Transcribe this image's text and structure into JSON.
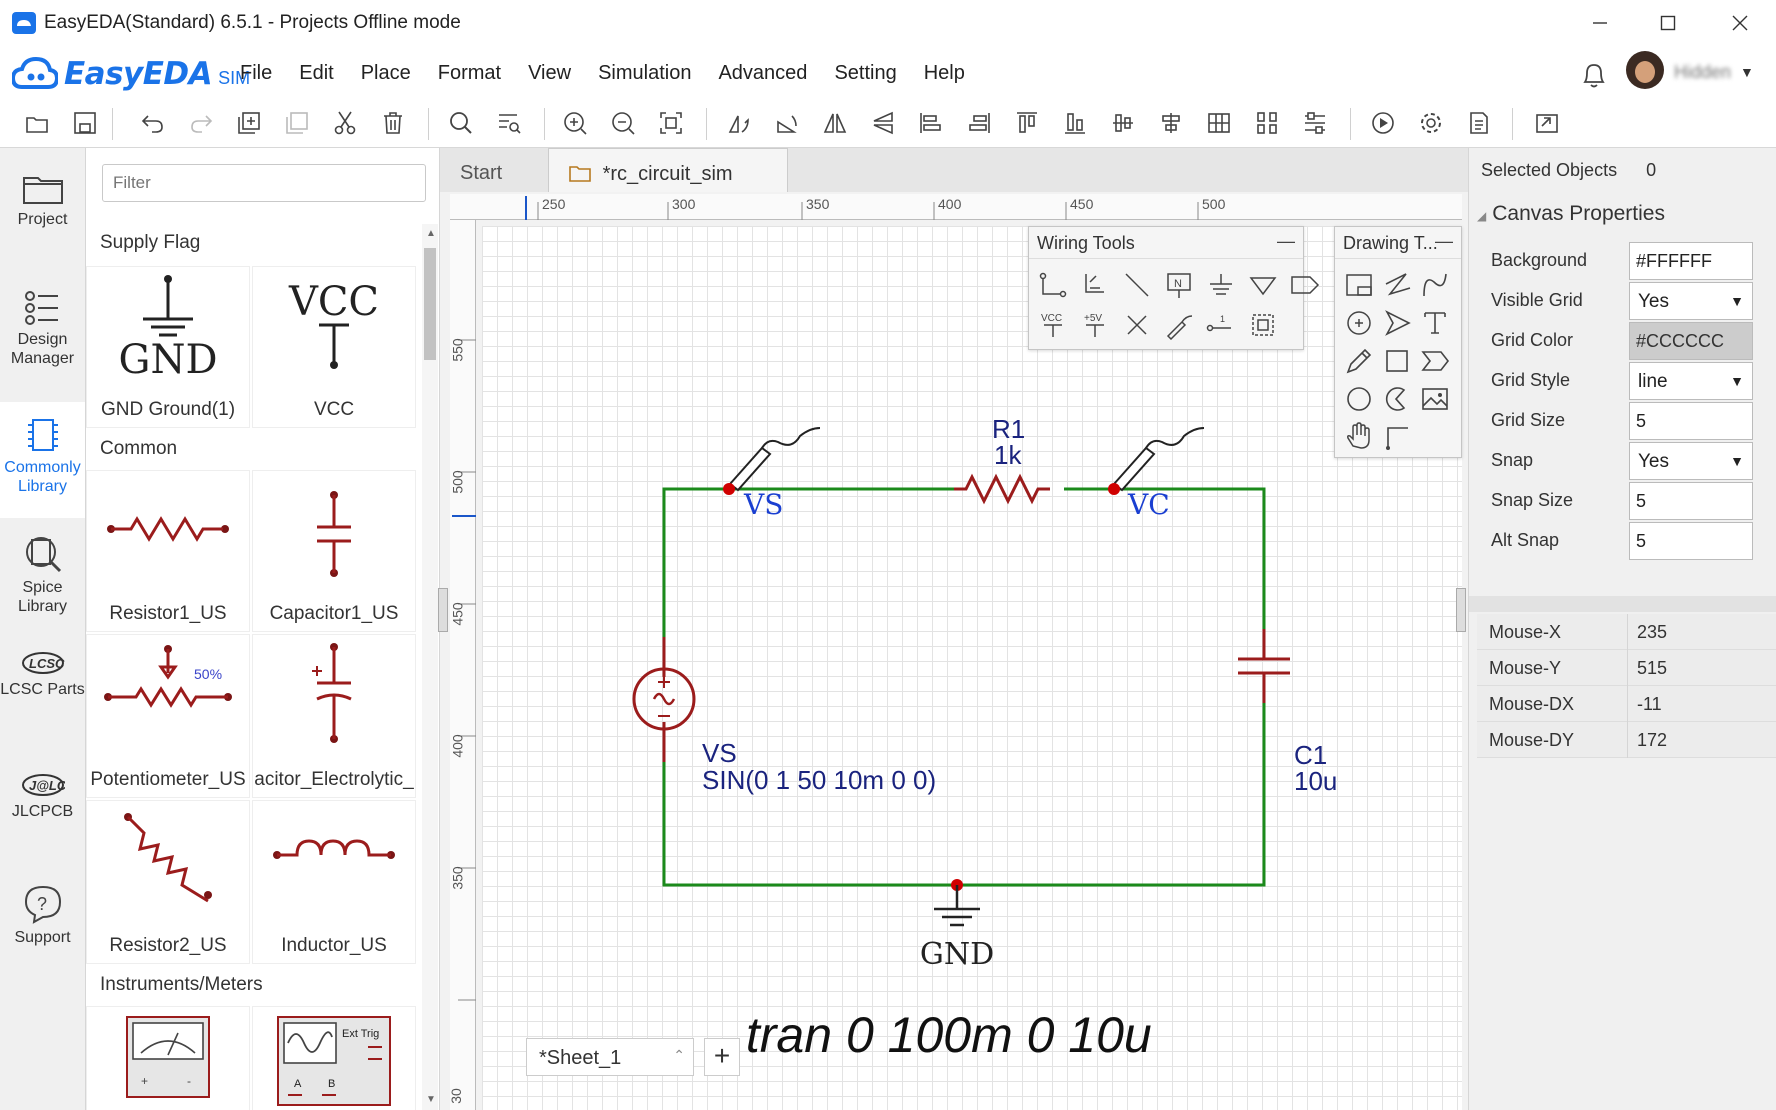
{
  "window": {
    "title": "EasyEDA(Standard) 6.5.1 - Projects Offline mode"
  },
  "brand": {
    "logo_text": "EasyEDA",
    "logo_suffix": "SIM",
    "color": "#1a73e8"
  },
  "menu": [
    "File",
    "Edit",
    "Place",
    "Format",
    "View",
    "Simulation",
    "Advanced",
    "Setting",
    "Help"
  ],
  "user": {
    "name": "Hidden"
  },
  "toolbar": {
    "icons": [
      "open-folder-icon",
      "save-icon",
      "undo-icon",
      "redo-icon",
      "copy-icon",
      "paste-icon",
      "cut-icon",
      "delete-icon",
      "search-icon",
      "find-list-icon",
      "zoom-in-icon",
      "zoom-out-icon",
      "fit-icon",
      "rotate-left-icon",
      "rotate-right-icon",
      "flip-horizontal-icon",
      "flip-vertical-icon",
      "align-left-icon",
      "align-right-icon",
      "align-top-icon",
      "align-bottom-icon",
      "align-center-v-icon",
      "align-center-h-icon",
      "distribute-h-icon",
      "distribute-v-icon",
      "align-grid-icon",
      "run-simulation-icon",
      "settings-icon",
      "document-icon",
      "export-icon"
    ]
  },
  "left_nav": [
    {
      "id": "project",
      "label": "Project"
    },
    {
      "id": "design-manager",
      "label": "Design Manager"
    },
    {
      "id": "commonly-library",
      "label": "Commonly Library",
      "active": true
    },
    {
      "id": "spice-library",
      "label": "Spice Library"
    },
    {
      "id": "lcsc-parts",
      "label": "LCSC Parts"
    },
    {
      "id": "jlcpcb",
      "label": "JLCPCB"
    },
    {
      "id": "support",
      "label": "Support"
    }
  ],
  "library": {
    "filter_placeholder": "Filter",
    "sections": [
      {
        "title": "Supply Flag",
        "items": [
          "GND Ground(1)",
          "VCC"
        ]
      },
      {
        "title": "Common",
        "items": [
          "Resistor1_US",
          "Capacitor1_US",
          "Potentiometer_US",
          "acitor_Electrolytic_",
          "Resistor2_US",
          "Inductor_US"
        ]
      },
      {
        "title": "Instruments/Meters",
        "items": []
      }
    ],
    "symbol_text": {
      "gnd": "GND",
      "vcc": "VCC",
      "pot_pct": "50%",
      "ext_trig": "Ext Trig",
      "a": "A",
      "b": "B"
    }
  },
  "tabs": [
    {
      "label": "Start"
    },
    {
      "label": "*rc_circuit_sim",
      "active": true
    }
  ],
  "ruler": {
    "top": [
      "250",
      "300",
      "350",
      "400",
      "450",
      "500"
    ],
    "left": [
      "550",
      "500",
      "450",
      "400",
      "350",
      "30"
    ]
  },
  "wiring_tools": {
    "title": "Wiring Tools",
    "labels": {
      "vcc": "VCC",
      "p5v": "+5V",
      "net": "N",
      "pin": "1"
    }
  },
  "drawing_tools": {
    "title": "Drawing T..."
  },
  "schematic": {
    "probe1": "VS",
    "probe2": "VC",
    "r1_name": "R1",
    "r1_value": "1k",
    "source_name": "VS",
    "source_value": "SIN(0 1 50 10m 0 0)",
    "c1_name": "C1",
    "c1_value": "10u",
    "ground": "GND",
    "directive": ".tran 0 100m 0 10u",
    "wire_color": "#1b8a1b",
    "component_color": "#9b1c1c",
    "label_color": "#1a237e"
  },
  "sheet": {
    "label": "*Sheet_1",
    "add": "+"
  },
  "properties": {
    "selected_label": "Selected Objects",
    "selected_count": "0",
    "section_title": "Canvas Properties",
    "rows": [
      {
        "label": "Background",
        "value": "#FFFFFF",
        "kind": "input"
      },
      {
        "label": "Visible Grid",
        "value": "Yes",
        "kind": "select"
      },
      {
        "label": "Grid Color",
        "value": "#CCCCCC",
        "kind": "color"
      },
      {
        "label": "Grid Style",
        "value": "line",
        "kind": "select"
      },
      {
        "label": "Grid Size",
        "value": "5",
        "kind": "input"
      },
      {
        "label": "Snap",
        "value": "Yes",
        "kind": "select"
      },
      {
        "label": "Snap Size",
        "value": "5",
        "kind": "input"
      },
      {
        "label": "Alt Snap",
        "value": "5",
        "kind": "input"
      }
    ],
    "mouse": [
      {
        "label": "Mouse-X",
        "value": "235"
      },
      {
        "label": "Mouse-Y",
        "value": "515"
      },
      {
        "label": "Mouse-DX",
        "value": "-11"
      },
      {
        "label": "Mouse-DY",
        "value": "172"
      }
    ]
  }
}
